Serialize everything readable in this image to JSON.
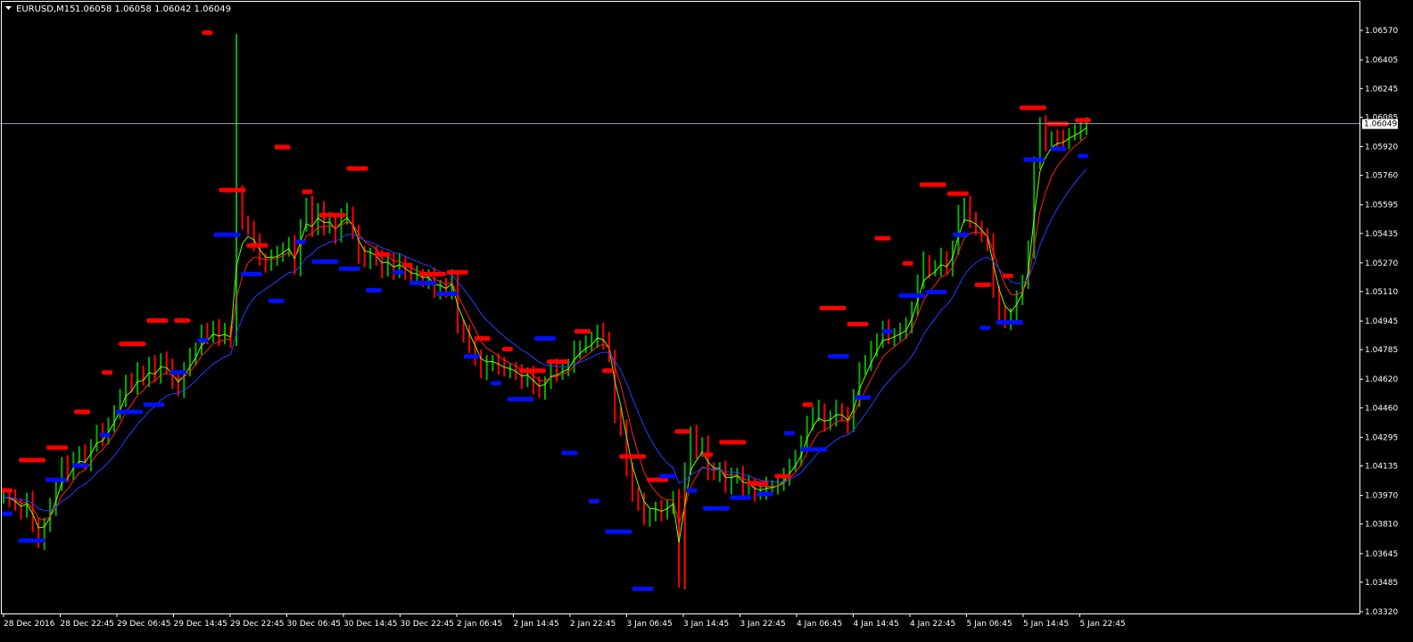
{
  "header": {
    "symbol": "EURUSD,M15",
    "quote_values": "1.06058 1.06058 1.06042 1.06049",
    "dropdown_icon": "triangle-down-icon"
  },
  "colors": {
    "background": "#000000",
    "frame": "#ffffff",
    "up_bar": "#00b000",
    "down_bar": "#ff0000",
    "ma_fast": "#7cfc00",
    "ma_mid": "#ff2020",
    "ma_slow": "#2040ff",
    "resistance_marker": "#ff0000",
    "support_marker": "#0010ff",
    "price_line": "#8fa7b8"
  },
  "chart_data": {
    "type": "line",
    "symbol": "EURUSD",
    "timeframe": "M15",
    "current_price": 1.06049,
    "current_price_label": "1.06049",
    "ylim": [
      1.0332,
      1.0673
    ],
    "y_ticks": [
      {
        "value": 1.0657,
        "label": "1.06570"
      },
      {
        "value": 1.06405,
        "label": "1.06405"
      },
      {
        "value": 1.06245,
        "label": "1.06245"
      },
      {
        "value": 1.06085,
        "label": "1.06085"
      },
      {
        "value": 1.0592,
        "label": "1.05920"
      },
      {
        "value": 1.0576,
        "label": "1.05760"
      },
      {
        "value": 1.05595,
        "label": "1.05595"
      },
      {
        "value": 1.05435,
        "label": "1.05435"
      },
      {
        "value": 1.0527,
        "label": "1.05270"
      },
      {
        "value": 1.0511,
        "label": "1.05110"
      },
      {
        "value": 1.04945,
        "label": "1.04945"
      },
      {
        "value": 1.04785,
        "label": "1.04785"
      },
      {
        "value": 1.0462,
        "label": "1.04620"
      },
      {
        "value": 1.0446,
        "label": "1.04460"
      },
      {
        "value": 1.04295,
        "label": "1.04295"
      },
      {
        "value": 1.04135,
        "label": "1.04135"
      },
      {
        "value": 1.0397,
        "label": "1.03970"
      },
      {
        "value": 1.0381,
        "label": "1.03810"
      },
      {
        "value": 1.03645,
        "label": "1.03645"
      },
      {
        "value": 1.03485,
        "label": "1.03485"
      },
      {
        "value": 1.0332,
        "label": "1.03320"
      }
    ],
    "x_ticks": [
      "28 Dec 2016",
      "28 Dec 22:45",
      "29 Dec 06:45",
      "29 Dec 14:45",
      "29 Dec 22:45",
      "30 Dec 06:45",
      "30 Dec 14:45",
      "30 Dec 22:45",
      "2 Jan 06:45",
      "2 Jan 14:45",
      "2 Jan 22:45",
      "3 Jan 06:45",
      "3 Jan 14:45",
      "3 Jan 22:45",
      "4 Jan 06:45",
      "4 Jan 14:45",
      "4 Jan 22:45",
      "5 Jan 06:45",
      "5 Jan 14:45",
      "5 Jan 22:45"
    ],
    "close": [
      1.0396,
      1.0395,
      1.0392,
      1.0388,
      1.0394,
      1.0381,
      1.0371,
      1.038,
      1.039,
      1.0403,
      1.0414,
      1.0409,
      1.0418,
      1.042,
      1.0415,
      1.0425,
      1.0432,
      1.0429,
      1.0437,
      1.0443,
      1.0451,
      1.0461,
      1.0458,
      1.0466,
      1.0462,
      1.047,
      1.0464,
      1.0473,
      1.0468,
      1.0461,
      1.0456,
      1.0467,
      1.0474,
      1.0479,
      1.0488,
      1.0486,
      1.0491,
      1.0485,
      1.0488,
      1.0484,
      1.0565,
      1.055,
      1.0546,
      1.0538,
      1.0529,
      1.0526,
      1.053,
      1.0531,
      1.0535,
      1.0537,
      1.0524,
      1.0548,
      1.0559,
      1.0546,
      1.0557,
      1.0547,
      1.055,
      1.0542,
      1.0553,
      1.0555,
      1.0544,
      1.0531,
      1.0528,
      1.0532,
      1.0529,
      1.0523,
      1.0528,
      1.0522,
      1.0527,
      1.0522,
      1.0519,
      1.052,
      1.0517,
      1.0519,
      1.0511,
      1.0514,
      1.0511,
      1.0518,
      1.0491,
      1.0487,
      1.048,
      1.0474,
      1.0466,
      1.047,
      1.0472,
      1.0469,
      1.0467,
      1.0467,
      1.0465,
      1.0461,
      1.0465,
      1.0458,
      1.0455,
      1.046,
      1.0468,
      1.0465,
      1.0468,
      1.0469,
      1.0478,
      1.048,
      1.0482,
      1.0483,
      1.0489,
      1.0483,
      1.0475,
      1.0442,
      1.0434,
      1.0412,
      1.0397,
      1.0393,
      1.0384,
      1.0386,
      1.0389,
      1.0387,
      1.0391,
      1.0395,
      1.0349,
      1.0412,
      1.0431,
      1.0422,
      1.0426,
      1.041,
      1.0409,
      1.0412,
      1.0402,
      1.0407,
      1.0409,
      1.0401,
      1.0403,
      1.0398,
      1.0399,
      1.0402,
      1.0402,
      1.0403,
      1.0407,
      1.0414,
      1.0418,
      1.0425,
      1.0438,
      1.0442,
      1.0445,
      1.0437,
      1.044,
      1.0445,
      1.0442,
      1.0436,
      1.0451,
      1.0468,
      1.0471,
      1.0478,
      1.0484,
      1.049,
      1.0485,
      1.0487,
      1.0489,
      1.0491,
      1.0502,
      1.0516,
      1.0528,
      1.0523,
      1.0524,
      1.053,
      1.0524,
      1.0535,
      1.0554,
      1.056,
      1.055,
      1.0547,
      1.0542,
      1.0538,
      1.0511,
      1.0498,
      1.0494,
      1.0496,
      1.0508,
      1.0516,
      1.0534,
      1.0583,
      1.0604,
      1.0594,
      1.0597,
      1.0596,
      1.0595,
      1.0599,
      1.06,
      1.0602,
      1.0605
    ],
    "resistance_levels": [
      {
        "price": 1.04,
        "label": "28 Dec"
      },
      {
        "price": 1.0417,
        "label": "28 Dec"
      },
      {
        "price": 1.0424,
        "label": "28 Dec"
      },
      {
        "price": 1.0444,
        "label": "29 Dec"
      },
      {
        "price": 1.0466,
        "label": "29 Dec"
      },
      {
        "price": 1.0482,
        "label": "29 Dec"
      },
      {
        "price": 1.0495,
        "label": "29 Dec"
      },
      {
        "price": 1.0495,
        "label": "29 Dec"
      },
      {
        "price": 1.0656,
        "label": "29 Dec"
      },
      {
        "price": 1.0568,
        "label": "29 Dec"
      },
      {
        "price": 1.0537,
        "label": "30 Dec"
      },
      {
        "price": 1.0592,
        "label": "30 Dec"
      },
      {
        "price": 1.0567,
        "label": "30 Dec"
      },
      {
        "price": 1.0554,
        "label": "30 Dec"
      },
      {
        "price": 1.058,
        "label": "30 Dec"
      },
      {
        "price": 1.0532,
        "label": "30 Dec"
      },
      {
        "price": 1.0526,
        "label": "30 Dec"
      },
      {
        "price": 1.0521,
        "label": "30 Dec"
      },
      {
        "price": 1.0522,
        "label": "2 Jan"
      },
      {
        "price": 1.0485,
        "label": "2 Jan"
      },
      {
        "price": 1.0479,
        "label": "2 Jan"
      },
      {
        "price": 1.0467,
        "label": "2 Jan"
      },
      {
        "price": 1.0472,
        "label": "2 Jan"
      },
      {
        "price": 1.0489,
        "label": "3 Jan"
      },
      {
        "price": 1.0467,
        "label": "3 Jan"
      },
      {
        "price": 1.0419,
        "label": "3 Jan"
      },
      {
        "price": 1.0406,
        "label": "3 Jan"
      },
      {
        "price": 1.0433,
        "label": "3 Jan"
      },
      {
        "price": 1.042,
        "label": "3 Jan"
      },
      {
        "price": 1.0427,
        "label": "3 Jan"
      },
      {
        "price": 1.0404,
        "label": "3 Jan"
      },
      {
        "price": 1.0408,
        "label": "3 Jan"
      },
      {
        "price": 1.0448,
        "label": "4 Jan"
      },
      {
        "price": 1.0502,
        "label": "4 Jan"
      },
      {
        "price": 1.0493,
        "label": "4 Jan"
      },
      {
        "price": 1.0541,
        "label": "4 Jan"
      },
      {
        "price": 1.0527,
        "label": "4 Jan"
      },
      {
        "price": 1.0571,
        "label": "5 Jan"
      },
      {
        "price": 1.0566,
        "label": "5 Jan"
      },
      {
        "price": 1.0515,
        "label": "5 Jan"
      },
      {
        "price": 1.052,
        "label": "5 Jan"
      },
      {
        "price": 1.0614,
        "label": "5 Jan"
      },
      {
        "price": 1.0605,
        "label": "5 Jan"
      },
      {
        "price": 1.0607,
        "label": "5 Jan"
      }
    ],
    "support_levels": [
      {
        "price": 1.0387,
        "label": "28 Dec"
      },
      {
        "price": 1.0372,
        "label": "28 Dec"
      },
      {
        "price": 1.0406,
        "label": "28 Dec"
      },
      {
        "price": 1.0414,
        "label": "28 Dec"
      },
      {
        "price": 1.0431,
        "label": "29 Dec"
      },
      {
        "price": 1.0444,
        "label": "29 Dec"
      },
      {
        "price": 1.0448,
        "label": "29 Dec"
      },
      {
        "price": 1.0466,
        "label": "29 Dec"
      },
      {
        "price": 1.0484,
        "label": "29 Dec"
      },
      {
        "price": 1.0543,
        "label": "29 Dec"
      },
      {
        "price": 1.0521,
        "label": "30 Dec"
      },
      {
        "price": 1.0506,
        "label": "30 Dec"
      },
      {
        "price": 1.0539,
        "label": "30 Dec"
      },
      {
        "price": 1.0528,
        "label": "30 Dec"
      },
      {
        "price": 1.0524,
        "label": "30 Dec"
      },
      {
        "price": 1.0512,
        "label": "30 Dec"
      },
      {
        "price": 1.0522,
        "label": "30 Dec"
      },
      {
        "price": 1.0516,
        "label": "30 Dec"
      },
      {
        "price": 1.051,
        "label": "2 Jan"
      },
      {
        "price": 1.0475,
        "label": "2 Jan"
      },
      {
        "price": 1.046,
        "label": "2 Jan"
      },
      {
        "price": 1.0451,
        "label": "2 Jan"
      },
      {
        "price": 1.0485,
        "label": "3 Jan"
      },
      {
        "price": 1.0421,
        "label": "3 Jan"
      },
      {
        "price": 1.0394,
        "label": "3 Jan"
      },
      {
        "price": 1.0377,
        "label": "3 Jan"
      },
      {
        "price": 1.0345,
        "label": "3 Jan"
      },
      {
        "price": 1.0408,
        "label": "3 Jan"
      },
      {
        "price": 1.04,
        "label": "3 Jan"
      },
      {
        "price": 1.039,
        "label": "4 Jan"
      },
      {
        "price": 1.0396,
        "label": "4 Jan"
      },
      {
        "price": 1.0398,
        "label": "4 Jan"
      },
      {
        "price": 1.0432,
        "label": "4 Jan"
      },
      {
        "price": 1.0423,
        "label": "4 Jan"
      },
      {
        "price": 1.0475,
        "label": "4 Jan"
      },
      {
        "price": 1.0452,
        "label": "4 Jan"
      },
      {
        "price": 1.0489,
        "label": "4 Jan"
      },
      {
        "price": 1.0509,
        "label": "4 Jan"
      },
      {
        "price": 1.0511,
        "label": "5 Jan"
      },
      {
        "price": 1.0543,
        "label": "5 Jan"
      },
      {
        "price": 1.0491,
        "label": "5 Jan"
      },
      {
        "price": 1.0494,
        "label": "5 Jan"
      },
      {
        "price": 1.0585,
        "label": "5 Jan"
      },
      {
        "price": 1.0591,
        "label": "5 Jan"
      },
      {
        "price": 1.0587,
        "label": "5 Jan"
      }
    ],
    "grid": false
  }
}
